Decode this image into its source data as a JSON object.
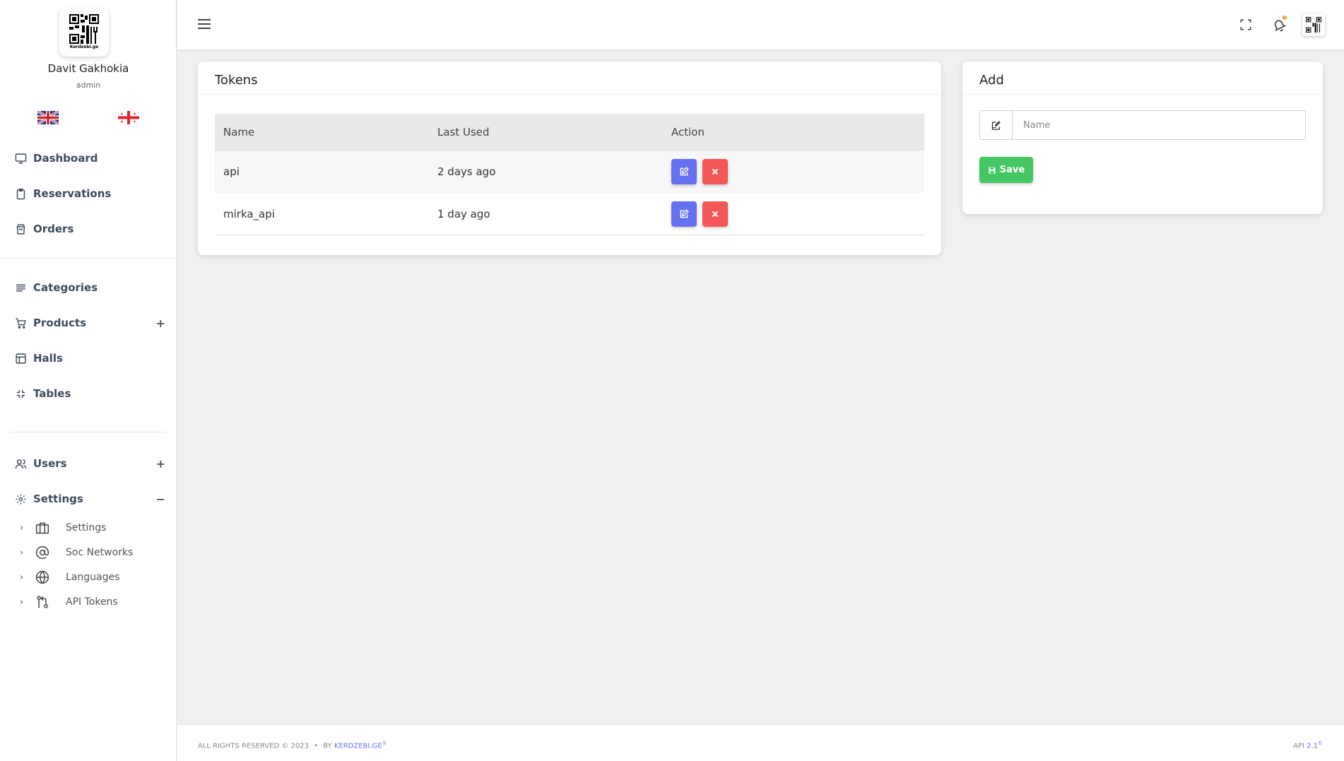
{
  "user": {
    "name": "Davit Gakhokia",
    "role": "admin",
    "logo_text": "Kerdzebi.ge"
  },
  "languages": [
    "English",
    "Georgian"
  ],
  "nav": {
    "dashboard": "Dashboard",
    "reservations": "Reservations",
    "orders": "Orders",
    "categories": "Categories",
    "products": "Products",
    "halls": "Halls",
    "tables": "Tables",
    "users": "Users",
    "settings": "Settings",
    "expand_symbol": "+",
    "collapse_symbol": "−"
  },
  "settings_sub": {
    "settings": "Settings",
    "soc_networks": "Soc Networks",
    "languages": "Languages",
    "api_tokens": "API Tokens",
    "chevron": "›"
  },
  "tokens_card": {
    "title": "Tokens",
    "columns": {
      "name": "Name",
      "last_used": "Last Used",
      "action": "Action"
    },
    "rows": [
      {
        "name": "api",
        "last_used": "2 days ago"
      },
      {
        "name": "mirka_api",
        "last_used": "1 day ago"
      }
    ]
  },
  "add_card": {
    "title": "Add",
    "name_placeholder": "Name",
    "save_label": "Save"
  },
  "footer": {
    "rights": "ALL RIGHTS RESERVED © 2023",
    "bullet": "•",
    "by": "BY",
    "brand": "KERDZEBI.GE",
    "brand_mark": "®",
    "api_label": "API",
    "api_version": "2.1",
    "version_mark": "©"
  },
  "colors": {
    "accent": "#6571f0",
    "danger": "#f25858",
    "success": "#44c763",
    "notification": "#f5a623"
  }
}
